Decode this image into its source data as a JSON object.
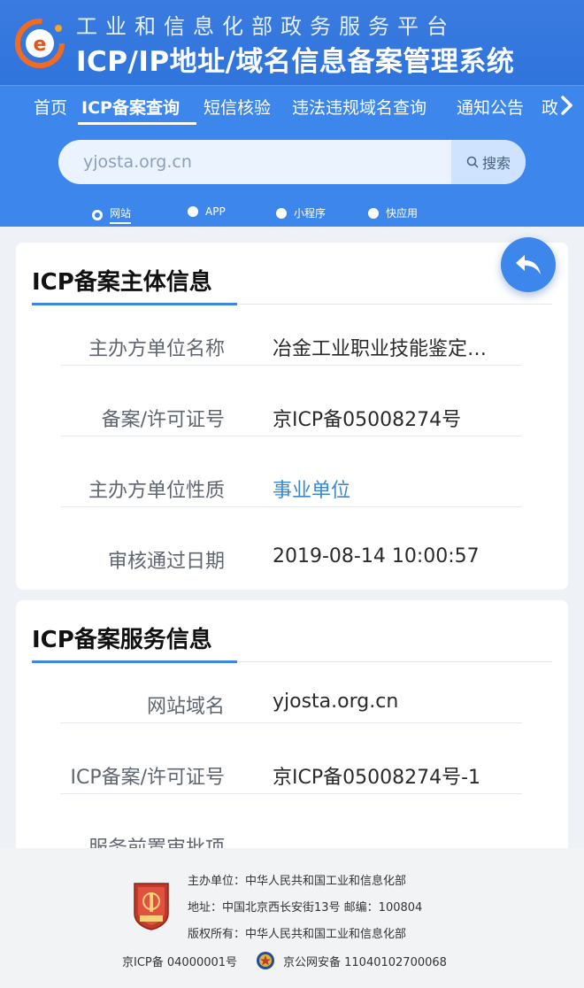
{
  "header": {
    "line1": "工业和信息化部政务服务平台",
    "line2": "ICP/IP地址/域名信息备案管理系统",
    "logo_icon": "e-gov-logo-icon"
  },
  "nav": {
    "items": [
      {
        "label": "首页"
      },
      {
        "label": "ICP备案查询",
        "active": true
      },
      {
        "label": "短信核验"
      },
      {
        "label": "违法违规域名查询"
      },
      {
        "label": "通知公告"
      },
      {
        "label": "政"
      }
    ],
    "more_icon": "chevron-right-icon"
  },
  "search": {
    "value": "yjosta.org.cn",
    "button_label": "搜索",
    "button_icon": "search-icon"
  },
  "types": [
    {
      "label": "网站",
      "selected": true
    },
    {
      "label": "APP"
    },
    {
      "label": "小程序"
    },
    {
      "label": "快应用"
    }
  ],
  "card1": {
    "title": "ICP备案主体信息",
    "rows": [
      {
        "label": "主办方单位名称",
        "value": "冶金工业职业技能鉴定…"
      },
      {
        "label": "备案/许可证号",
        "value": "京ICP备05008274号"
      },
      {
        "label": "主办方单位性质",
        "value": "事业单位"
      },
      {
        "label": "审核通过日期",
        "value": "2019-08-14 10:00:57"
      }
    ]
  },
  "card2": {
    "title": "ICP备案服务信息",
    "rows": [
      {
        "label": "网站域名",
        "value": "yjosta.org.cn"
      },
      {
        "label": "ICP备案/许可证号",
        "value": "京ICP备05008274号-1"
      },
      {
        "label": "服务前置审批项",
        "value": ""
      }
    ]
  },
  "back_button_icon": "back-arrow-icon",
  "footer": {
    "host": "主办单位：中华人民共和国工业和信息化部",
    "address": "地址：中国北京西长安街13号 邮编：100804",
    "copyright": "版权所有：中华人民共和国工业和信息化部",
    "icp": "京ICP备 04000001号",
    "psb": "京公网安备 11040102700068",
    "emblem_icon": "dangzheng-jiguan-emblem-icon",
    "police_icon": "police-badge-icon"
  },
  "colors": {
    "header_bg": "#3a7be0",
    "nav_bg": "#3d87ec",
    "accent": "#3c87e0",
    "link": "#3a88cf"
  }
}
